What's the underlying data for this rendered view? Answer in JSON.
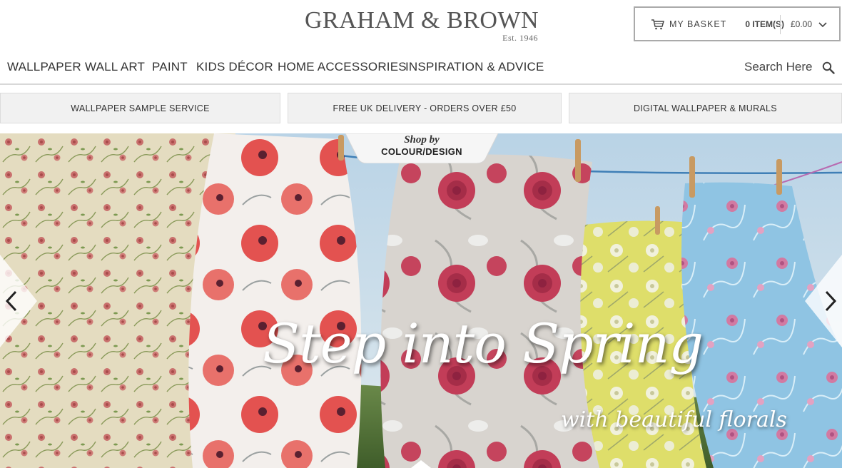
{
  "brand": {
    "name": "GRAHAM & BROWN",
    "est": "Est. 1946"
  },
  "basket": {
    "label": "MY BASKET",
    "items": "0 ITEM(S)",
    "total": "£0.00"
  },
  "nav": {
    "items": [
      "WALLPAPER",
      "WALL ART",
      "PAINT",
      "KIDS DÉCOR",
      "HOME ACCESSORIES",
      "INSPIRATION & ADVICE"
    ],
    "search_label": "Search Here"
  },
  "promos": [
    "WALLPAPER SAMPLE SERVICE",
    "FREE UK DELIVERY - ORDERS OVER £50",
    "DIGITAL WALLPAPER & MURALS"
  ],
  "hero": {
    "shop_by": "Shop by",
    "shop_by_sub": "COLOUR/DESIGN",
    "headline": "Step into Spring",
    "subline": "with beautiful florals"
  },
  "colors": {
    "accent": "#555555",
    "promo_bg": "#f1f1f1",
    "border": "#aaaaaa"
  }
}
